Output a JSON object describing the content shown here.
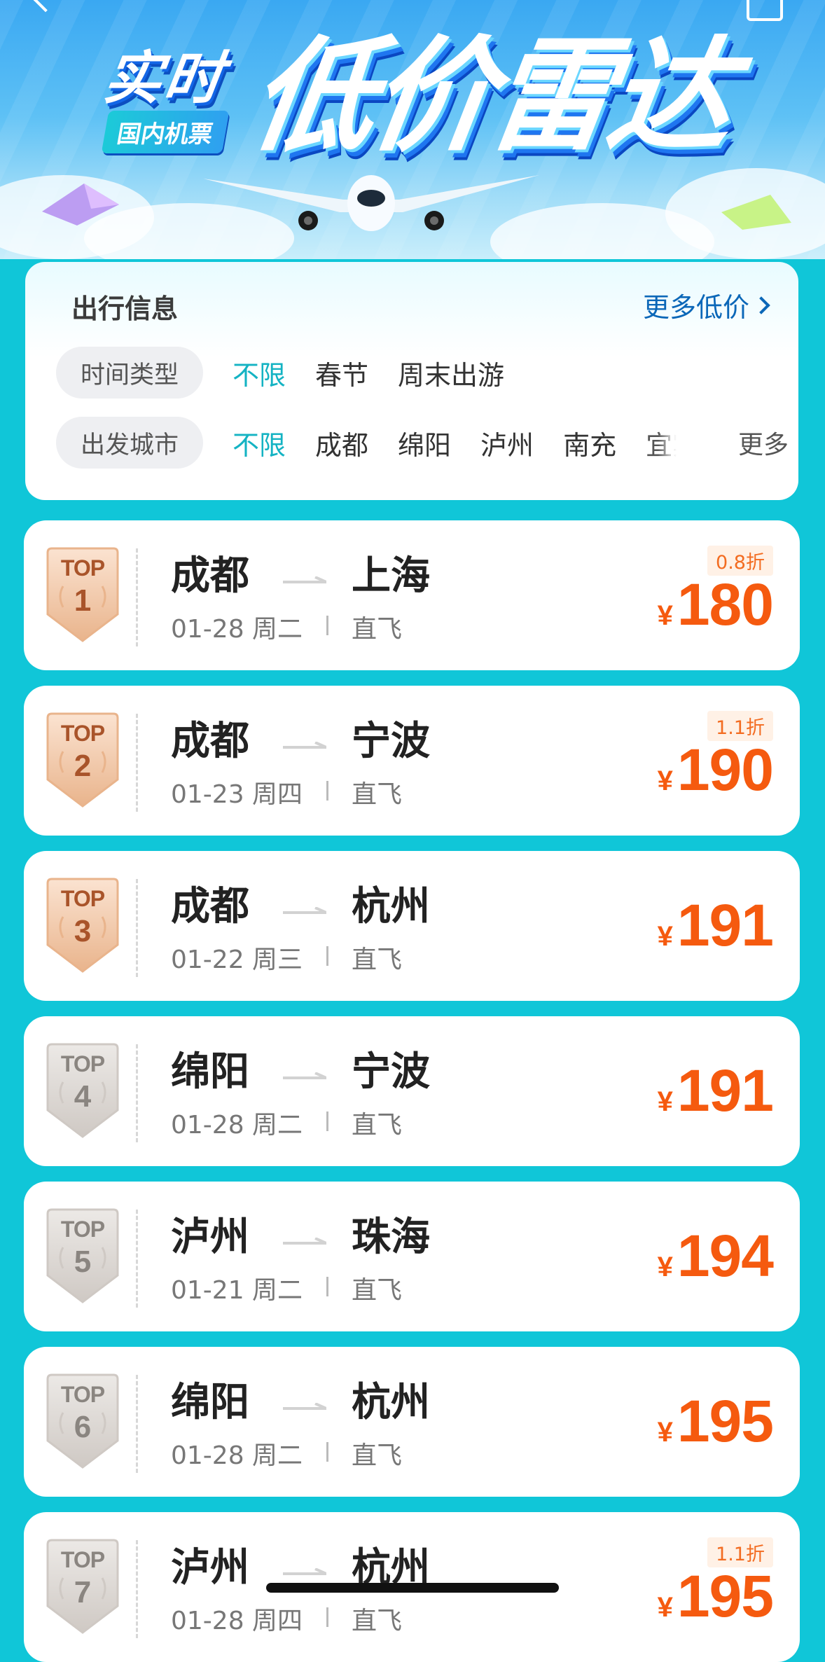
{
  "hero": {
    "title_small": "实时",
    "tag": "国内机票",
    "title_big": "低价雷达"
  },
  "filter": {
    "title": "出行信息",
    "more_low_price": "更多低价",
    "time_type_label": "时间类型",
    "time_options": [
      "不限",
      "春节",
      "周末出游"
    ],
    "city_label": "出发城市",
    "city_options": [
      "不限",
      "成都",
      "绵阳",
      "泸州",
      "南充",
      "宜宾"
    ],
    "more": "更多",
    "active_color": "#14b3c3"
  },
  "routes": [
    {
      "rank_text": "TOP",
      "rank": "1",
      "from": "成都",
      "to": "上海",
      "date": "01-28 周二",
      "type": "直飞",
      "discount": "0.8折",
      "currency": "¥",
      "price": "180"
    },
    {
      "rank_text": "TOP",
      "rank": "2",
      "from": "成都",
      "to": "宁波",
      "date": "01-23 周四",
      "type": "直飞",
      "discount": "1.1折",
      "currency": "¥",
      "price": "190"
    },
    {
      "rank_text": "TOP",
      "rank": "3",
      "from": "成都",
      "to": "杭州",
      "date": "01-22 周三",
      "type": "直飞",
      "discount": "",
      "currency": "¥",
      "price": "191"
    },
    {
      "rank_text": "TOP",
      "rank": "4",
      "from": "绵阳",
      "to": "宁波",
      "date": "01-28 周二",
      "type": "直飞",
      "discount": "",
      "currency": "¥",
      "price": "191"
    },
    {
      "rank_text": "TOP",
      "rank": "5",
      "from": "泸州",
      "to": "珠海",
      "date": "01-21 周二",
      "type": "直飞",
      "discount": "",
      "currency": "¥",
      "price": "194"
    },
    {
      "rank_text": "TOP",
      "rank": "6",
      "from": "绵阳",
      "to": "杭州",
      "date": "01-28 周二",
      "type": "直飞",
      "discount": "",
      "currency": "¥",
      "price": "195"
    },
    {
      "rank_text": "TOP",
      "rank": "7",
      "from": "泸州",
      "to": "杭州",
      "date": "01-28 周四",
      "type": "直飞",
      "discount": "1.1折",
      "currency": "¥",
      "price": "195"
    }
  ],
  "colors": {
    "background": "#10c6d8",
    "price": "#f55a0f",
    "badge_bronze": "#e9b48c",
    "badge_silver": "#cfc9c4"
  }
}
